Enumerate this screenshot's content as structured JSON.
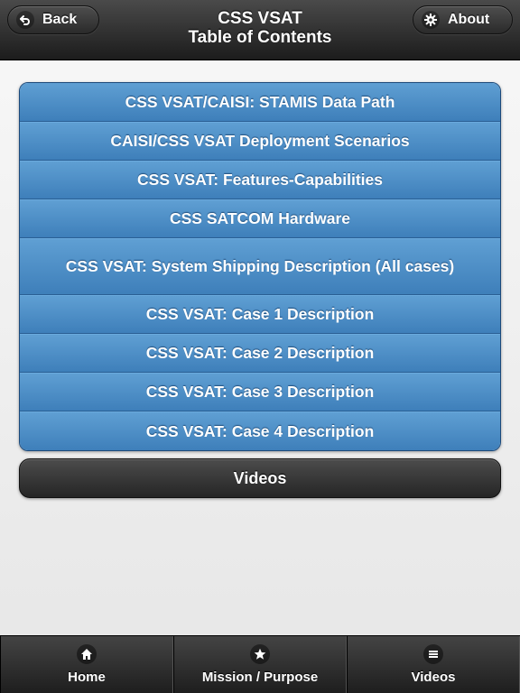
{
  "header": {
    "title_line1": "CSS VSAT",
    "title_line2": "Table of Contents",
    "back_label": "Back",
    "about_label": "About"
  },
  "toc": {
    "items": [
      {
        "label": "CSS VSAT/CAISI: STAMIS Data Path"
      },
      {
        "label": "CAISI/CSS VSAT Deployment Scenarios"
      },
      {
        "label": "CSS VSAT: Features-Capabilities"
      },
      {
        "label": "CSS SATCOM Hardware"
      },
      {
        "label": "CSS VSAT: System Shipping Description (All cases)"
      },
      {
        "label": "CSS VSAT: Case 1 Description"
      },
      {
        "label": "CSS VSAT: Case 2 Description"
      },
      {
        "label": "CSS VSAT: Case 3 Description"
      },
      {
        "label": "CSS VSAT: Case 4 Description"
      }
    ]
  },
  "videos_button": {
    "label": "Videos"
  },
  "footer": {
    "tabs": [
      {
        "label": "Home",
        "icon": "home-icon"
      },
      {
        "label": "Mission / Purpose",
        "icon": "star-icon"
      },
      {
        "label": "Videos",
        "icon": "menu-icon"
      }
    ]
  },
  "colors": {
    "list_blue": "#4a8cc6",
    "header_dark": "#2a2a2a",
    "background": "#efefef"
  }
}
